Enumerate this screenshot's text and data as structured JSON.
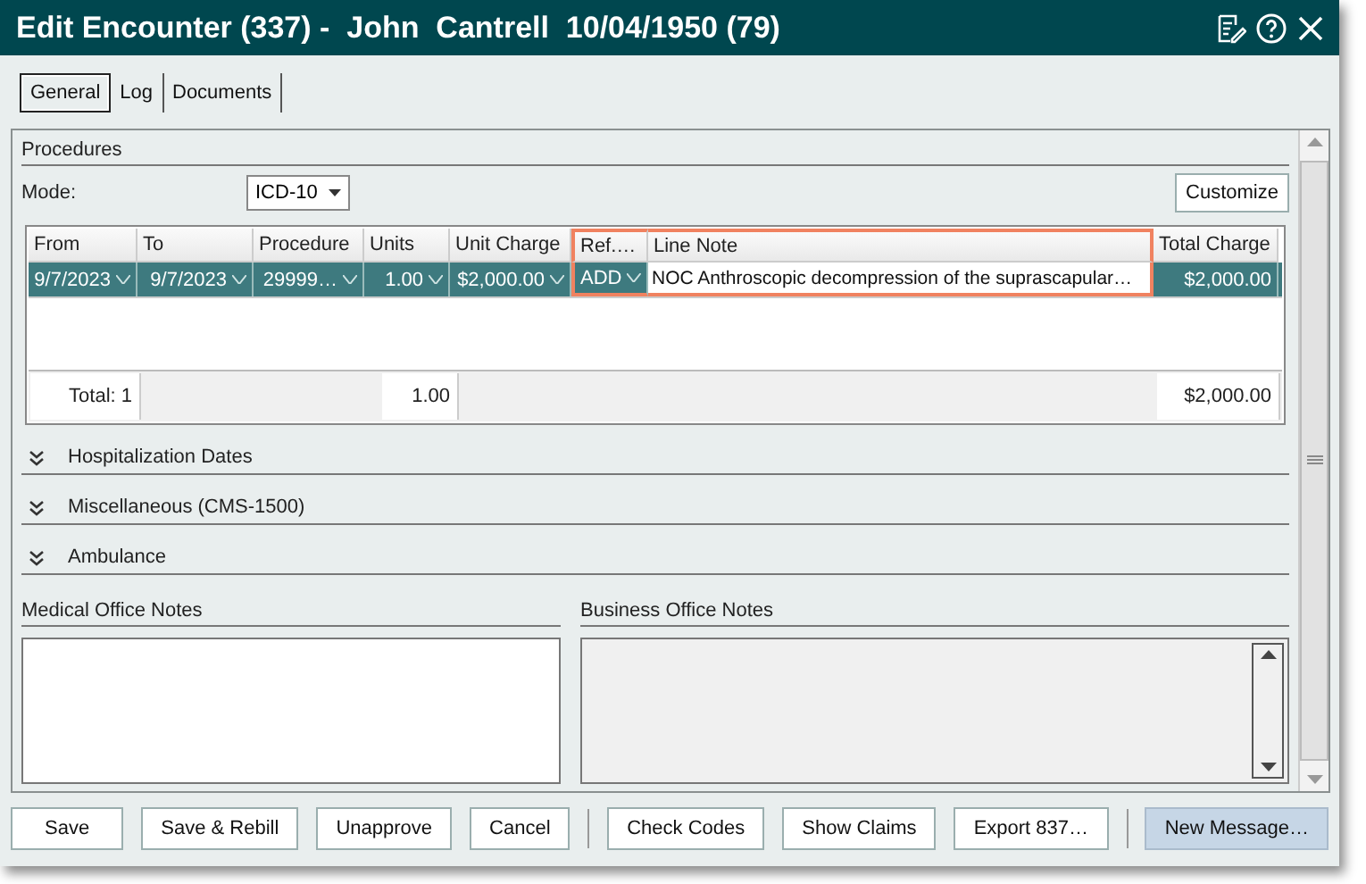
{
  "window": {
    "title": "Edit Encounter (337) -  John  Cantrell  10/04/1950 (79)"
  },
  "tabs": [
    {
      "label": "General",
      "selected": true
    },
    {
      "label": "Log",
      "selected": false
    },
    {
      "label": "Documents",
      "selected": false
    }
  ],
  "procedures": {
    "title": "Procedures",
    "mode_label": "Mode:",
    "mode_value": "ICD-10",
    "customize_button": "Customize",
    "columns": [
      {
        "label": "From",
        "highlighted": false
      },
      {
        "label": "To",
        "highlighted": false
      },
      {
        "label": "Procedure",
        "highlighted": false
      },
      {
        "label": "Units",
        "highlighted": false
      },
      {
        "label": "Unit Charge",
        "highlighted": false
      },
      {
        "label": "Ref.…",
        "highlighted": true
      },
      {
        "label": "Line Note",
        "highlighted": true
      },
      {
        "label": "Total Charge",
        "highlighted": false
      }
    ],
    "rows": [
      {
        "selected": true,
        "cells": [
          {
            "text": "9/7/2023",
            "dropdown": true,
            "editing": false
          },
          {
            "text": "9/7/2023",
            "dropdown": true,
            "editing": false
          },
          {
            "text": "29999…",
            "dropdown": true,
            "editing": false
          },
          {
            "text": "1.00",
            "dropdown": true,
            "editing": false
          },
          {
            "text": "$2,000.00",
            "dropdown": true,
            "editing": false
          },
          {
            "text": "ADD",
            "dropdown": true,
            "editing": false
          },
          {
            "text": "NOC Anthroscopic decompression of the suprascapular…",
            "dropdown": false,
            "editing": true
          },
          {
            "text": "$2,000.00",
            "dropdown": false,
            "editing": false
          }
        ]
      }
    ],
    "totals": {
      "count": "Total: 1",
      "units": "1.00",
      "total_charge": "$2,000.00"
    }
  },
  "sections": [
    {
      "title": "Hospitalization Dates",
      "expanded": false
    },
    {
      "title": "Miscellaneous (CMS-1500)",
      "expanded": false
    },
    {
      "title": "Ambulance",
      "expanded": false
    }
  ],
  "notes": [
    {
      "label": "Medical Office Notes",
      "disabled": false
    },
    {
      "label": "Business Office Notes",
      "disabled": true
    }
  ],
  "buttons": [
    {
      "label": "Save",
      "highlighted": false
    },
    {
      "label": "Save & Rebill",
      "highlighted": false
    },
    {
      "label": "Unapprove",
      "highlighted": false
    },
    {
      "label": "Cancel",
      "highlighted": false
    },
    {
      "label": "Check Codes",
      "highlighted": false
    },
    {
      "label": "Show Claims",
      "highlighted": false
    },
    {
      "label": "Export 837…",
      "highlighted": false
    },
    {
      "label": "New Message…",
      "highlighted": true
    }
  ]
}
